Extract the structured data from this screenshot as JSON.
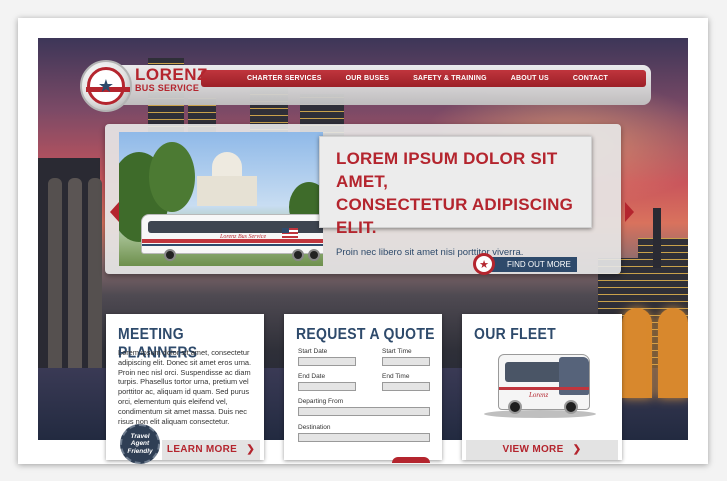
{
  "brand": {
    "name": "LORENZ",
    "tagline": "BUS SERVICE",
    "bus_livery_text": "Lorenz Bus Service",
    "coach_livery_text": "Lorenz",
    "colors": {
      "red": "#b4252e",
      "navy": "#2e4a6b",
      "light_gray": "#e3e3e3"
    }
  },
  "nav": {
    "items": [
      "CHARTER SERVICES",
      "OUR BUSES",
      "SAFETY & TRAINING",
      "ABOUT US",
      "CONTACT"
    ]
  },
  "hero": {
    "title_line1": "LOREM IPSUM DOLOR SIT AMET,",
    "title_line2": "CONSECTETUR ADIPISCING ELIT.",
    "subtitle": "Proin nec libero sit amet nisi porttitor viverra.",
    "cta_label": "FIND OUT MORE",
    "cta_icon": "star-icon",
    "prev_icon": "chevron-left-icon",
    "next_icon": "chevron-right-icon"
  },
  "planners": {
    "title": "MEETING PLANNERS",
    "body": "Lorem ipsum dolor sit amet, consectetur adipiscing elit. Donec sit amet eros urna. Proin nec nisl orci. Suspendisse ac diam turpis. Phasellus tortor urna, pretium vel porttitor ac, aliquam id quam. Sed purus orci, elementum quis eleifend vel, condimentum sit amet massa. Duis nec risus non elit aliquam consectetur.",
    "badge_line1": "Travel",
    "badge_line2": "Agent",
    "badge_line3": "Friendly",
    "button_label": "LEARN MORE",
    "button_icon": "chevron-right-icon"
  },
  "quote": {
    "title": "REQUEST A QUOTE",
    "start_date_label": "Start Date",
    "start_time_label": "Start Time",
    "end_date_label": "End Date",
    "end_time_label": "End Time",
    "departing_label": "Departing From",
    "destination_label": "Destination",
    "start_date_value": "",
    "start_time_value": "",
    "end_date_value": "",
    "end_time_value": "",
    "departing_value": "",
    "destination_value": ""
  },
  "fleet": {
    "title": "OUR FLEET",
    "button_label": "VIEW MORE",
    "button_icon": "chevron-right-icon"
  }
}
